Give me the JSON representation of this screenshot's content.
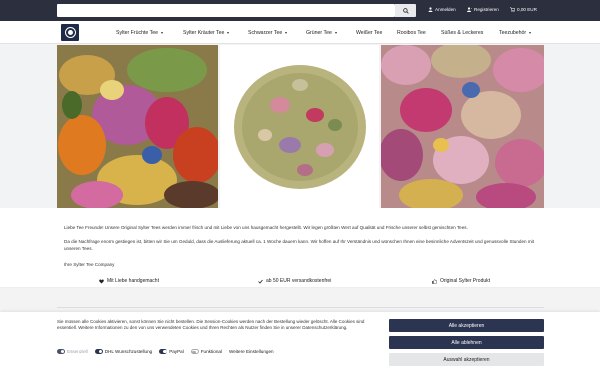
{
  "header": {
    "search_placeholder": "",
    "links": [
      {
        "label": "Anmelden",
        "icon": "user-icon"
      },
      {
        "label": "Registrieren",
        "icon": "user-plus-icon"
      },
      {
        "label": "0,00 EUR",
        "icon": "cart-icon"
      }
    ]
  },
  "nav": {
    "items": [
      {
        "label": "Sylter Früchte Tee",
        "dropdown": true
      },
      {
        "label": "Sylter Kräuter Tee",
        "dropdown": true
      },
      {
        "label": "Schwarzer Tee",
        "dropdown": true
      },
      {
        "label": "Grüner Tee",
        "dropdown": true
      },
      {
        "label": "Weißer Tee",
        "dropdown": false
      },
      {
        "label": "Rooibos Tee",
        "dropdown": false
      },
      {
        "label": "Süßes & Leckeres",
        "dropdown": false
      },
      {
        "label": "Teezubehör",
        "dropdown": true
      }
    ]
  },
  "intro": {
    "p1": "Liebe Tee Freunde! Unsere Original Sylter Tees werden immer frisch und mit Liebe von uns hausgemacht hergestellt. Wir legen größten Wert auf Qualität und Frische unserer selbst gemischten Tees.",
    "p2": "Da die Nachfrage enorm gestiegen ist, bitten wir Sie um Geduld, dass die Auslieferung aktuell ca. 1 Woche dauern kann. Wir hoffen auf Ihr Verständnis und wünschen Ihnen eine besinnliche Adventszeit und genussvolle Stunden mit unseren Tees.",
    "signature": "Ihre Sylter Tee Company"
  },
  "usps": [
    {
      "label": "Mit Liebe handgemacht",
      "icon": "heart-icon"
    },
    {
      "label": "ab 50 EUR versandkostenfrei",
      "icon": "check-icon"
    },
    {
      "label": "Original Sylter Produkt",
      "icon": "thumbs-up-icon"
    }
  ],
  "cookie": {
    "text": "Sie müssen alle Cookies aktivieren, sonst können Sie nicht bestellen. Die Session-Cookies werden nach der Bestellung wieder gelöscht. Alle Cookies sind essentiell. Weitere Informationen zu den von uns verwendeten Cookies und Ihren Rechten als Nutzer finden Sie in unserer Datenschutzerklärung.",
    "toggles": [
      {
        "label": "Essenziell",
        "on": true,
        "disabled": true
      },
      {
        "label": "DHL Wunschzustellung",
        "on": true
      },
      {
        "label": "PayPal",
        "on": true
      },
      {
        "label": "Funktional",
        "on": false
      }
    ],
    "more_settings": "Weitere Einstellungen",
    "accept_all": "Alle akzeptieren",
    "reject_all": "Alle ablehnen",
    "accept_selection": "Auswahl akzeptieren"
  },
  "colors": {
    "header_bg": "#2b2f3e",
    "primary_button": "#2b3551",
    "secondary_button": "#e5e6e8"
  }
}
